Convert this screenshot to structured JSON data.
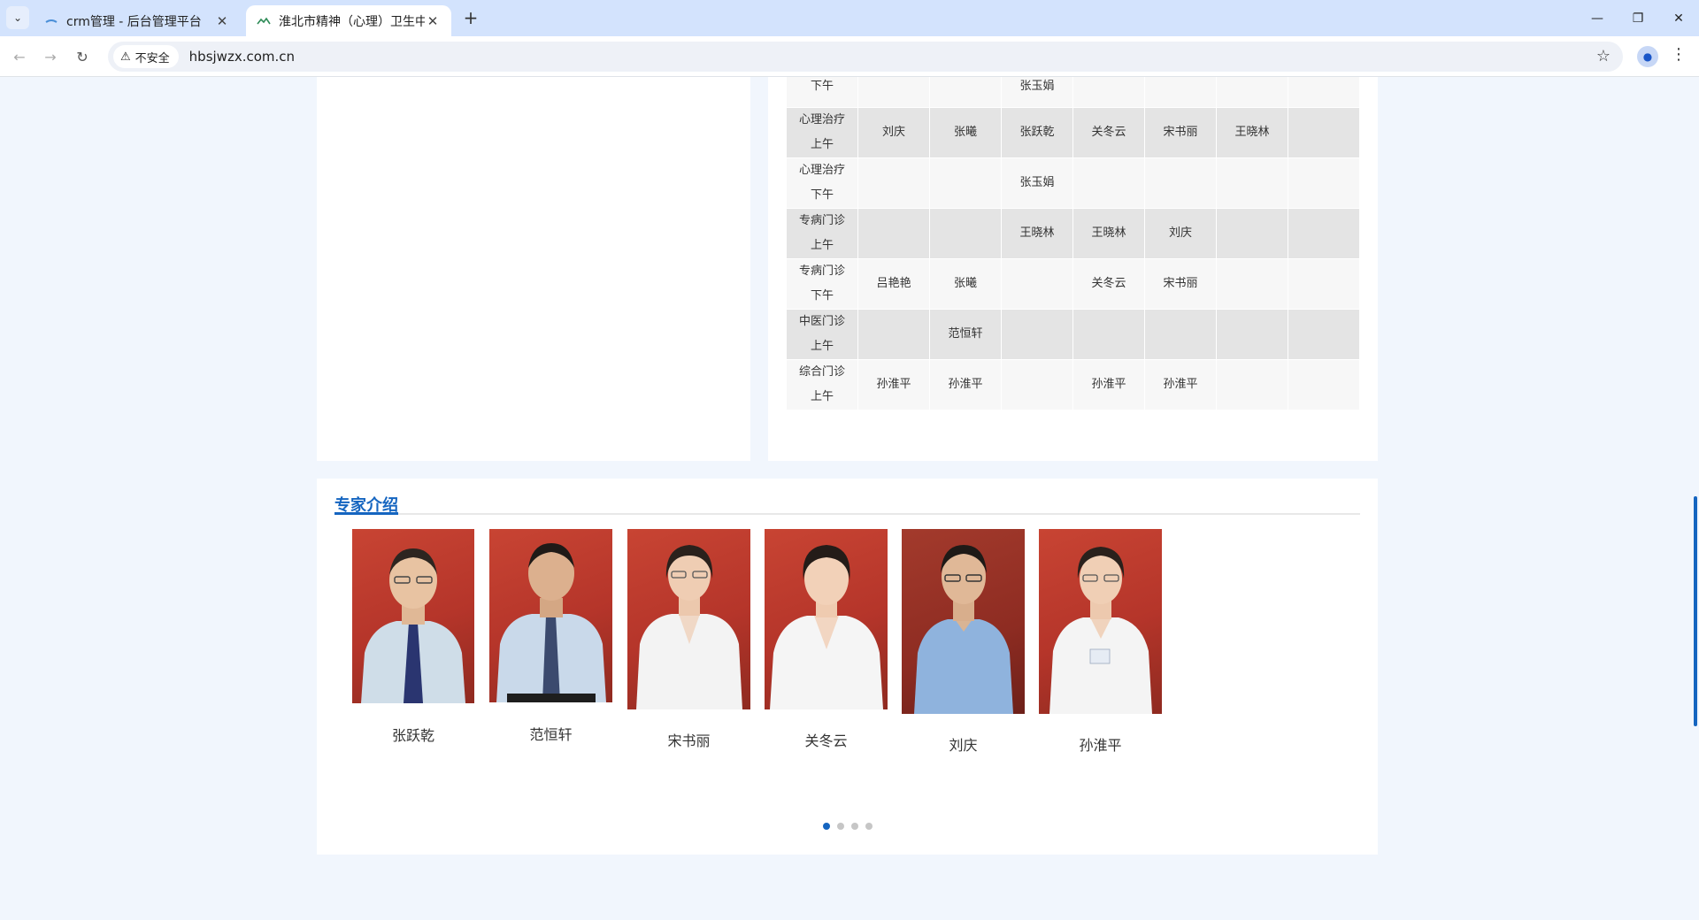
{
  "browser": {
    "tabs": [
      {
        "title": "crm管理 - 后台管理平台",
        "close": "✕"
      },
      {
        "title": "淮北市精神（心理）卫生中心",
        "close": "✕"
      }
    ],
    "new_tab": "+",
    "window_controls": {
      "minimize": "—",
      "restore": "❐",
      "close": "✕"
    },
    "security_label": "不安全",
    "url": "hbsjwzx.com.cn"
  },
  "schedule": {
    "rows": [
      {
        "session": [
          "",
          "下午"
        ],
        "cells": [
          "",
          "",
          "张玉娟",
          "",
          "",
          "",
          ""
        ]
      },
      {
        "session": [
          "心理治疗",
          "上午"
        ],
        "cells": [
          "刘庆",
          "张曦",
          "张跃乾",
          "关冬云",
          "宋书丽",
          "王晓林",
          ""
        ]
      },
      {
        "session": [
          "心理治疗",
          "下午"
        ],
        "cells": [
          "",
          "",
          "张玉娟",
          "",
          "",
          "",
          ""
        ]
      },
      {
        "session": [
          "专病门诊",
          "上午"
        ],
        "cells": [
          "",
          "",
          "王晓林",
          "王晓林",
          "刘庆",
          "",
          ""
        ]
      },
      {
        "session": [
          "专病门诊",
          "下午"
        ],
        "cells": [
          "吕艳艳",
          "张曦",
          "",
          "关冬云",
          "宋书丽",
          "",
          ""
        ]
      },
      {
        "session": [
          "中医门诊",
          "上午"
        ],
        "cells": [
          "",
          "范恒轩",
          "",
          "",
          "",
          "",
          ""
        ]
      },
      {
        "session": [
          "综合门诊",
          "上午"
        ],
        "cells": [
          "孙淮平",
          "孙淮平",
          "",
          "孙淮平",
          "孙淮平",
          "",
          ""
        ]
      }
    ]
  },
  "experts": {
    "title": "专家介绍",
    "doctors": [
      {
        "name": "张跃乾"
      },
      {
        "name": "范恒轩"
      },
      {
        "name": "宋书丽"
      },
      {
        "name": "关冬云"
      },
      {
        "name": "刘庆"
      },
      {
        "name": "孙淮平"
      }
    ],
    "carousel_pages": 4,
    "carousel_active": 1
  }
}
